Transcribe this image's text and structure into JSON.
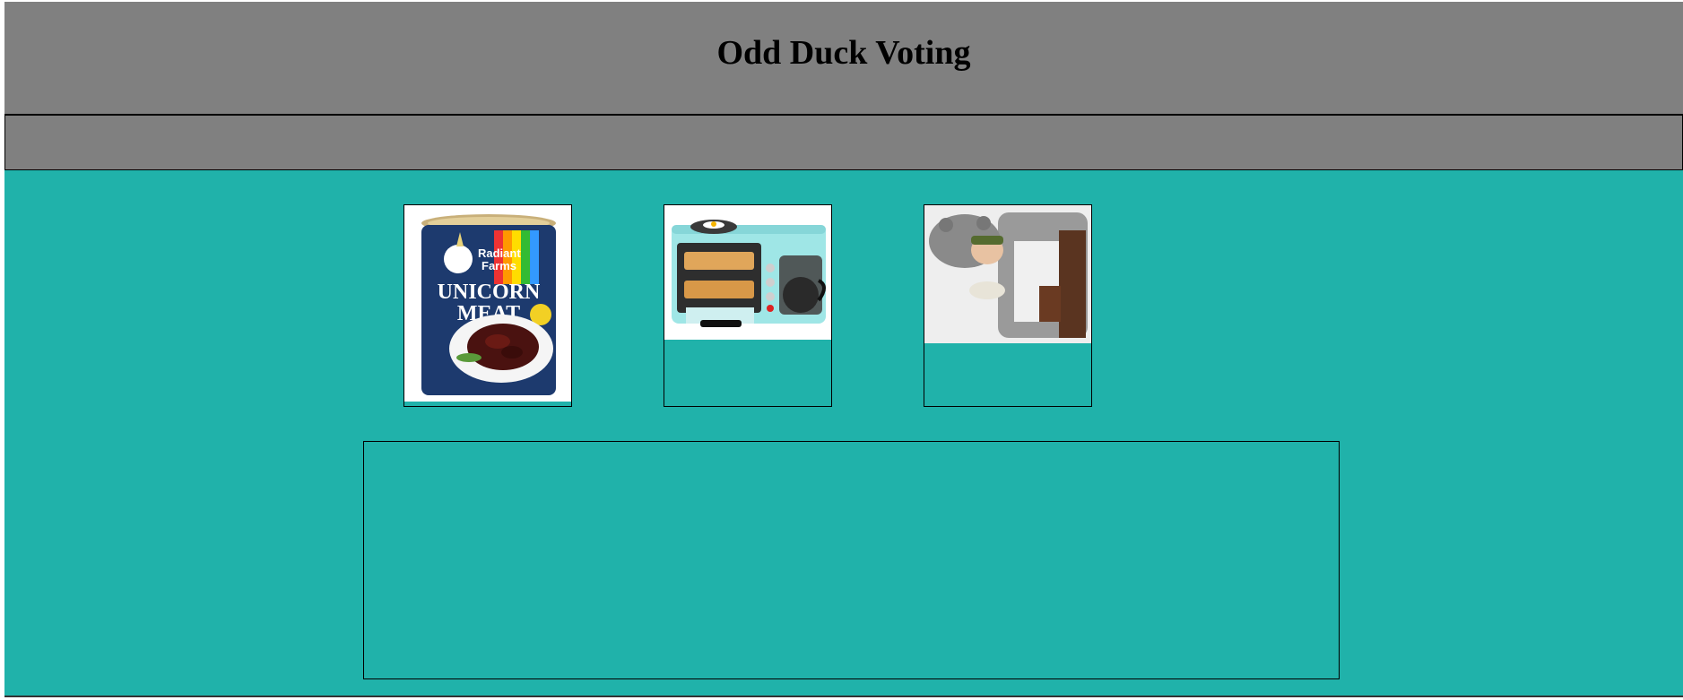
{
  "header": {
    "title": "Odd Duck Voting"
  },
  "products": [
    {
      "name_label": "unicorn meat can",
      "can_text": {
        "brand_line1": "Radiant",
        "brand_line2": "Farms",
        "title_line1": "UNICORN",
        "title_line2": "MEAT"
      }
    },
    {
      "name_label": "breakfast station"
    },
    {
      "name_label": "tauntaun sleeping bag"
    }
  ],
  "colors": {
    "header_bg": "#808080",
    "main_bg": "#20b2aa"
  }
}
